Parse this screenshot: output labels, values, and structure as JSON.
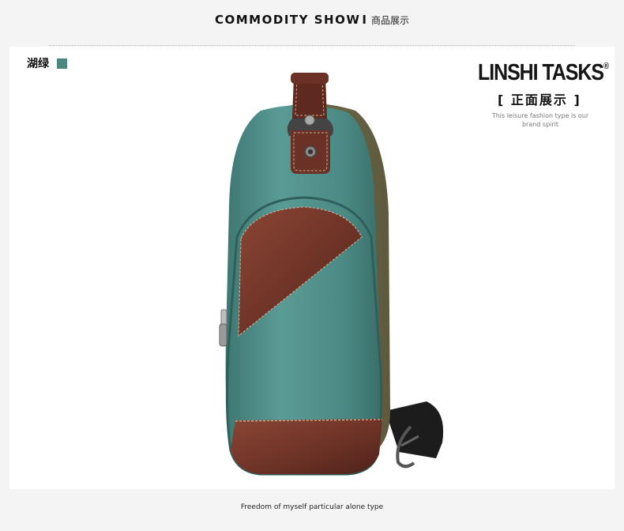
{
  "header": {
    "title_en": "COMMODITY SHOW",
    "separator": "I",
    "title_cn": "商品展示"
  },
  "product": {
    "color_name": "湖绿",
    "swatch_color": "#4a8780",
    "canvas_color": "#4f8e89",
    "leather_color": "#6b3126"
  },
  "brand": {
    "logo": "LINSHI TASKS",
    "registered_mark": "®",
    "subtitle": "[ 正面展示 ]",
    "description": "This leisure fashion type is our brand spirit"
  },
  "footer": {
    "caption": "Freedom of myself particular alone type"
  }
}
